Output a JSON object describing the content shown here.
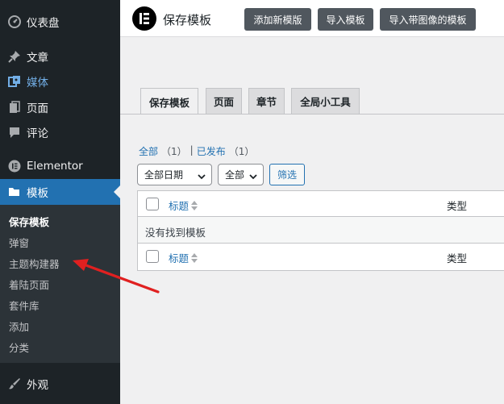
{
  "sidebar": {
    "items": [
      {
        "label": "仪表盘",
        "icon": "dashboard-icon"
      },
      {
        "label": "文章",
        "icon": "pin-icon"
      },
      {
        "label": "媒体",
        "icon": "media-icon"
      },
      {
        "label": "页面",
        "icon": "pages-icon"
      },
      {
        "label": "评论",
        "icon": "comment-icon"
      },
      {
        "label": "Elementor",
        "icon": "elementor-icon"
      },
      {
        "label": "模板",
        "icon": "folder-icon"
      },
      {
        "label": "外观",
        "icon": "brush-icon"
      }
    ],
    "submenu": [
      "保存模板",
      "弹窗",
      "主题构建器",
      "着陆页面",
      "套件库",
      "添加",
      "分类"
    ]
  },
  "header": {
    "title": "保存模板",
    "buttons": [
      "添加新模版",
      "导入模板",
      "导入带图像的模板"
    ]
  },
  "tabs": [
    "保存模板",
    "页面",
    "章节",
    "全局小工具"
  ],
  "filters": {
    "all_label": "全部",
    "all_count": "（1）",
    "separator": "|",
    "published_label": "已发布",
    "published_count": "（1）",
    "date_select": "全部日期",
    "type_select": "全部",
    "filter_button": "筛选"
  },
  "table": {
    "col_title": "标题",
    "col_type": "类型",
    "empty_message": "没有找到模板"
  },
  "colors": {
    "sidebar_bg": "#1d2327",
    "accent": "#2271b1",
    "annotation_arrow": "#e02020"
  }
}
